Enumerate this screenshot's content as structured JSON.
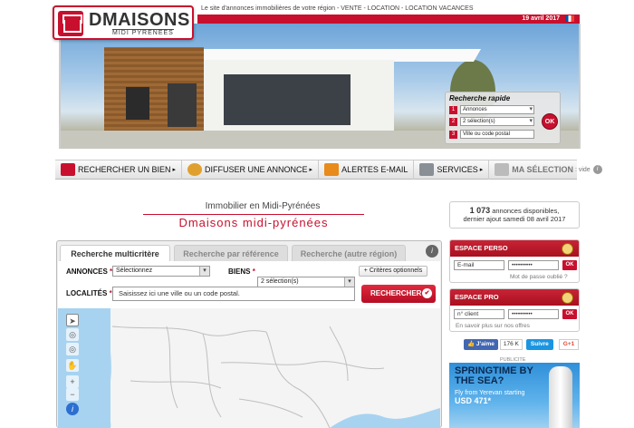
{
  "brand": {
    "name": "DMAISONS",
    "sub": "MIDI PYRENEES"
  },
  "tagline": "Le site d'annonces immobilières de votre région - VENTE - LOCATION - LOCATION VACANCES",
  "date": "19 avril 2017",
  "quick_search": {
    "title": "Recherche rapide",
    "rows": [
      {
        "num": "1",
        "value": "Annonces"
      },
      {
        "num": "2",
        "value": "2 sélection(s)"
      },
      {
        "num": "3",
        "value": "Ville ou code postal"
      }
    ],
    "ok": "OK"
  },
  "nav": {
    "items": [
      {
        "label": "RECHERCHER UN BIEN",
        "color": "#c8102e"
      },
      {
        "label": "DIFFUSER UNE ANNONCE",
        "color": "#e0a030"
      },
      {
        "label": "ALERTES E-MAIL",
        "color": "#e88b1a"
      },
      {
        "label": "SERVICES",
        "color": "#8a8f96"
      }
    ],
    "selection_label": "MA SÉLECTION",
    "selection_count": ": vide"
  },
  "intro": {
    "line1": "Immobilier en Midi-Pyrénées",
    "line2": "Dmaisons midi-pyrénées"
  },
  "availability": {
    "count": "1 073",
    "count_text": "annonces disponibles,",
    "last": "dernier ajout samedi 08 avril 2017"
  },
  "search": {
    "tabs": [
      "Recherche multicritère",
      "Recherche par référence",
      "Recherche (autre région)"
    ],
    "annonces_label": "ANNONCES",
    "annonces_value": "Sélectionnez",
    "biens_label": "BIENS",
    "biens_value": "2 sélection(s)",
    "criteria_button": "+ Critères optionnels",
    "localites_label": "LOCALITÉS",
    "localites_placeholder": "Saisissez ici une ville ou un code postal.",
    "search_button": "RECHERCHER"
  },
  "espace_perso": {
    "title": "ESPACE PERSO",
    "email_placeholder": "E-mail",
    "password_value": "••••••••••",
    "ok": "OK",
    "forgot": "Mot de passe oublié ?"
  },
  "espace_pro": {
    "title": "ESPACE PRO",
    "client_placeholder": "n° client",
    "password_value": "••••••••••",
    "ok": "OK",
    "more": "En savoir plus sur nos offres"
  },
  "social": {
    "fb_like": "J'aime",
    "fb_count": "176 K",
    "twitter": "Suivre",
    "gplus": "G+1"
  },
  "ad": {
    "label": "PUBLICITE",
    "headline": "SPRINGTIME BY THE SEA?",
    "body": "Fly from Yerevan starting",
    "price": "USD 471*"
  },
  "colors": {
    "accent": "#c8102e"
  }
}
